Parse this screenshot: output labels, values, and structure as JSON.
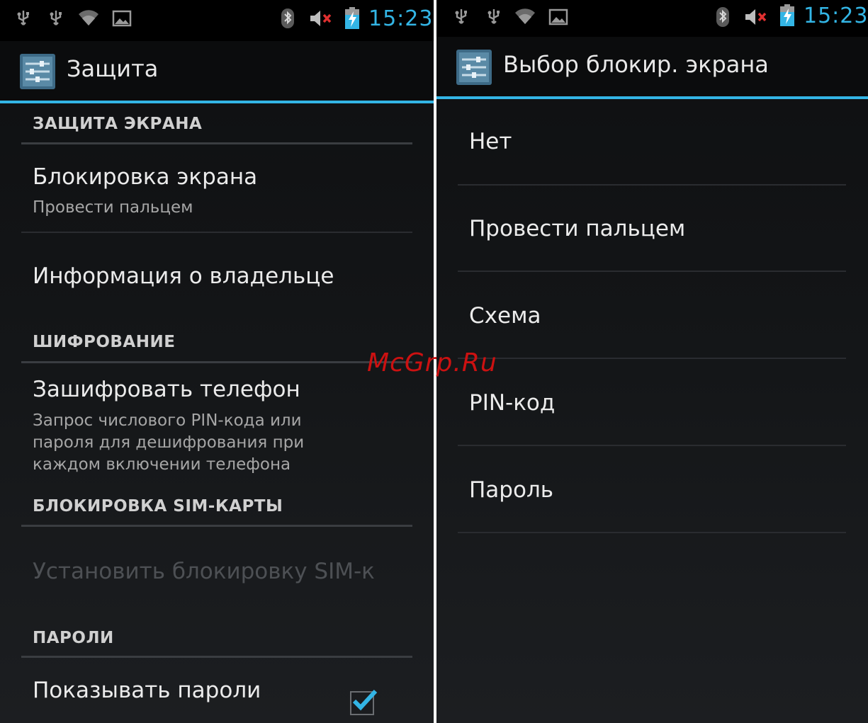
{
  "status_bar": {
    "time": "15:23",
    "icons_left": [
      "usb-icon",
      "usb-icon",
      "wifi-icon",
      "image-icon"
    ],
    "icons_right": [
      "bluetooth-icon",
      "muted-speaker-icon",
      "battery-charging-icon"
    ],
    "time_color": "#33b5e5"
  },
  "left": {
    "title": "Защита",
    "sections": {
      "screen": "ЗАЩИТА ЭКРАНА",
      "encryption": "ШИФРОВАНИЕ",
      "sim": "БЛОКИРОВКА SIM-КАРТЫ",
      "passwords": "ПАРОЛИ"
    },
    "items": {
      "screen_lock_title": "Блокировка экрана",
      "screen_lock_summary": "Провести пальцем",
      "owner_info": "Информация о владельце",
      "encrypt_title": "Зашифровать телефон",
      "encrypt_summary": "Запрос числового PIN-кода или пароля для дешифрования при каждом включении телефона",
      "sim_lock": "Установить блокировку SIM-к",
      "show_passwords": "Показывать пароли"
    },
    "show_passwords_checked": true
  },
  "right": {
    "title": "Выбор блокир. экрана",
    "options": [
      "Нет",
      "Провести пальцем",
      "Схема",
      "PIN-код",
      "Пароль"
    ]
  },
  "watermark": "McGrp.Ru",
  "colors": {
    "accent": "#33b5e5",
    "watermark": "#cc1111"
  }
}
